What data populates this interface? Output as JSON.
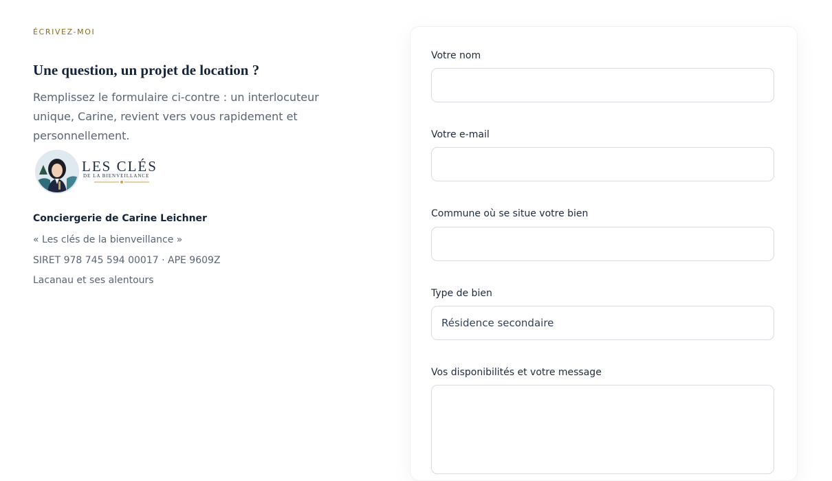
{
  "intro_section": {
    "eyebrow": "ÉCRIVEZ-MOI",
    "heading": "Une question, un projet de location ?",
    "paragraph": "Remplissez le formulaire ci-contre : un interlocuteur unique, Carine, revient vers vous rapidement et personnellement."
  },
  "logo": {
    "title": "LES CLÉS",
    "subtitle": "DE LA BIENVEILLANCE"
  },
  "company": {
    "name": "Conciergerie de Carine Leichner",
    "tagline": "« Les clés de la bienveillance »",
    "registration": "SIRET 978 745 594 00017 · APE 9609Z",
    "area": "Lacanau et ses alentours"
  },
  "form": {
    "name_label": "Votre nom",
    "name_value": "",
    "email_label": "Votre e-mail",
    "email_value": "",
    "commune_label": "Commune où se situe votre bien",
    "commune_value": "",
    "property_type_label": "Type de bien",
    "property_type_value": "Résidence secondaire",
    "message_label": "Vos disponibilités et votre message",
    "message_value": ""
  },
  "colors": {
    "eyebrow": "#8a6a1f",
    "heading": "#15243a",
    "body_text": "#5b6472",
    "border": "#d9dde3"
  }
}
